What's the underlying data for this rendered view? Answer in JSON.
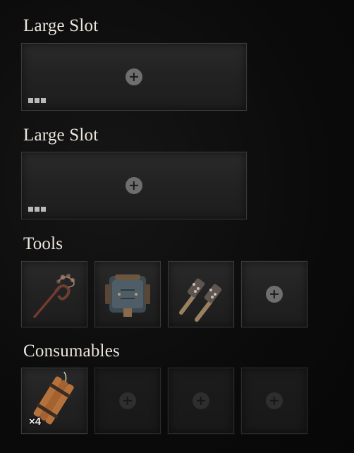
{
  "sections": {
    "large_slot_1": {
      "title": "Large Slot",
      "indicator": "■■■"
    },
    "large_slot_2": {
      "title": "Large Slot",
      "indicator": "■■■"
    },
    "tools": {
      "title": "Tools",
      "items": [
        {
          "name": "whip-tool-icon",
          "equipped": true
        },
        {
          "name": "backpack-tool-icon",
          "equipped": true
        },
        {
          "name": "dual-maces-tool-icon",
          "equipped": true
        },
        {
          "name": "empty",
          "equipped": false
        }
      ]
    },
    "consumables": {
      "title": "Consumables",
      "items": [
        {
          "name": "dynamite-bundle-icon",
          "equipped": true,
          "quantity": "×4"
        },
        {
          "name": "empty",
          "equipped": false
        },
        {
          "name": "empty",
          "equipped": false
        },
        {
          "name": "empty",
          "equipped": false
        }
      ]
    }
  }
}
